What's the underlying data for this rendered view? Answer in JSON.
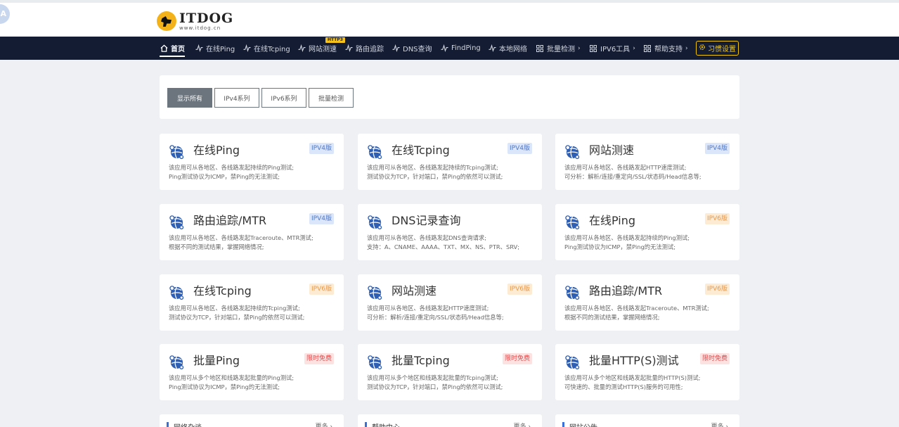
{
  "brand": {
    "avatar_letter": "A",
    "logo_title": "ITDOG",
    "logo_url": "www.itdog.cn",
    "accent": "#131c33",
    "yellow": "#f1c40f"
  },
  "nav": {
    "items": [
      {
        "label": "首页",
        "icon": "home-icon"
      },
      {
        "label": "在线Ping",
        "icon": "pulse-icon"
      },
      {
        "label": "在线Tcping",
        "icon": "pulse-icon"
      },
      {
        "label": "网站测速",
        "icon": "pulse-icon"
      },
      {
        "label": "路由追踪",
        "icon": "pulse-icon"
      },
      {
        "label": "DNS查询",
        "icon": "pulse-icon"
      },
      {
        "label": "FindPing",
        "icon": "pulse-icon"
      },
      {
        "label": "本地网络",
        "icon": "pulse-icon"
      },
      {
        "label": "批量检测",
        "icon": "grid-icon"
      },
      {
        "label": "IPV6工具",
        "icon": "grid-icon"
      },
      {
        "label": "帮助支持",
        "icon": "grid-icon"
      }
    ],
    "http3_badge": "HTTP3",
    "chevron": "›",
    "pref_label": "习惯设置"
  },
  "filters": [
    "显示所有",
    "IPv4系列",
    "IPv6系列",
    "批量检测"
  ],
  "tools": [
    {
      "name": "在线Ping",
      "badge": "IPV4版",
      "badge_type": "v4",
      "desc1": "该应用可从各地区、各线路发起持续的Ping测试;",
      "desc2": "Ping测试协议为ICMP，禁Ping的无法测试;"
    },
    {
      "name": "在线Tcping",
      "badge": "IPV4版",
      "badge_type": "v4",
      "desc1": "该应用可从各地区、各线路发起持续的Tcping测试;",
      "desc2": "测试协议为TCP，针对端口，禁Ping的依然可以测试;"
    },
    {
      "name": "网站测速",
      "badge": "IPV4版",
      "badge_type": "v4",
      "desc1": "该应用可从各地区、各线路发起HTTP速度测试;",
      "desc2": "可分析：解析/连接/重定向/SSL/状态码/Head信息等;"
    },
    {
      "name": "路由追踪/MTR",
      "badge": "IPV4版",
      "badge_type": "v4",
      "desc1": "该应用可从各地区、各线路发起Traceroute、MTR测试;",
      "desc2": "根据不同的测试结果，掌握网络情况;"
    },
    {
      "name": "DNS记录查询",
      "badge": "",
      "badge_type": "",
      "desc1": "该应用可从各地区、各线路发起DNS查询请求;",
      "desc2": "支持：A、CNAME、AAAA、TXT、MX、NS、PTR、SRV;"
    },
    {
      "name": "在线Ping",
      "badge": "IPV6版",
      "badge_type": "v6",
      "desc1": "该应用可从各地区、各线路发起持续的Ping测试;",
      "desc2": "Ping测试协议为ICMP，禁Ping的无法测试;"
    },
    {
      "name": "在线Tcping",
      "badge": "IPV6版",
      "badge_type": "v6",
      "desc1": "该应用可从各地区、各线路发起持续的Tcping测试;",
      "desc2": "测试协议为TCP，针对端口，禁Ping的依然可以测试;"
    },
    {
      "name": "网站测速",
      "badge": "IPV6版",
      "badge_type": "v6",
      "desc1": "该应用可从各地区、各线路发起HTTP速度测试;",
      "desc2": "可分析：解析/连接/重定向/SSL/状态码/Head信息等;"
    },
    {
      "name": "路由追踪/MTR",
      "badge": "IPV6版",
      "badge_type": "v6",
      "desc1": "该应用可从各地区、各线路发起Traceroute、MTR测试;",
      "desc2": "根据不同的测试结果，掌握网络情况;"
    },
    {
      "name": "批量Ping",
      "badge": "限时免费",
      "badge_type": "free",
      "desc1": "该应用可从多个地区和线路发起批量的Ping测试;",
      "desc2": "Ping测试协议为ICMP，禁Ping的无法测试;"
    },
    {
      "name": "批量Tcping",
      "badge": "限时免费",
      "badge_type": "free",
      "desc1": "该应用可从多个地区和线路发起批量的Tcping测试;",
      "desc2": "测试协议为TCP，针对端口，禁Ping的依然可以测试;"
    },
    {
      "name": "批量HTTP(S)测试",
      "badge": "限时免费",
      "badge_type": "free",
      "desc1": "该应用可从多个地区和线路发起批量的HTTP(S)测试;",
      "desc2": "可快速的、批量的测试HTTP(S)服务的可用性;"
    }
  ],
  "bottom": [
    {
      "title": "网络杂谈",
      "more": "更多 ›"
    },
    {
      "title": "帮助中心",
      "more": "更多 ›"
    },
    {
      "title": "网站公告",
      "more": "更多 ›"
    }
  ]
}
